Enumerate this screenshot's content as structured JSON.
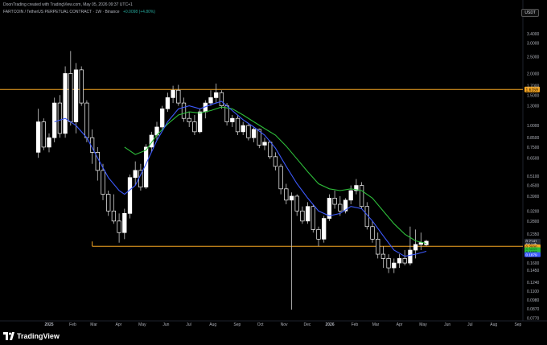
{
  "header": {
    "credit": "DoonTrading created with TradingView.com, May 05, 2026 09:37 UTC+1",
    "symbol_line": "FARTCOIN / TetherUS PERPETUAL CONTRACT · 1W · Binance",
    "change": "+0.0098 (+4.80%)",
    "currency_badge": "USDT"
  },
  "brand": {
    "name": "TradingView"
  },
  "colors": {
    "background": "#000000",
    "candle_up": "#ffffff",
    "candle_down": "#ffffff",
    "ma_fast": "#3d5afe",
    "ma_slow": "#2ebd3a",
    "level_line": "#f5a623",
    "change_text": "#26a69a"
  },
  "chart_data": {
    "type": "candlestick",
    "y_scale": "log",
    "ylim": [
      0.074,
      4.3
    ],
    "y_ticks": [
      "3.4000",
      "3.0000",
      "2.5000",
      "2.0000",
      "1.7000",
      "1.5000",
      "1.3000",
      "1.0000",
      "0.8500",
      "0.7500",
      "0.6500",
      "0.5100",
      "0.4500",
      "0.3900",
      "0.3200",
      "0.2800",
      "0.2350",
      "0.1900",
      "0.1600",
      "0.1450",
      "0.1240",
      "0.1100",
      "0.0980",
      "0.0870",
      "0.0770"
    ],
    "y_tick_values": [
      3.4,
      3.0,
      2.5,
      2.0,
      1.7,
      1.5,
      1.3,
      1.0,
      0.85,
      0.75,
      0.65,
      0.51,
      0.45,
      0.39,
      0.32,
      0.28,
      0.235,
      0.19,
      0.16,
      0.145,
      0.124,
      0.11,
      0.098,
      0.087,
      0.077
    ],
    "x_labels": [
      "2025",
      "Feb",
      "Mar",
      "Apr",
      "May",
      "Jun",
      "Jul",
      "Aug",
      "Sep",
      "Oct",
      "Nov",
      "Dec",
      "2026",
      "Feb",
      "Mar",
      "Apr",
      "May",
      "Jun",
      "Jul",
      "Aug",
      "Sep"
    ],
    "x_label_weeks": [
      0,
      4.4,
      8.3,
      12.9,
      17.3,
      21.7,
      25.9,
      30.4,
      34.9,
      39.2,
      43.6,
      47.9,
      52.1,
      56.7,
      60.6,
      65.0,
      69.4,
      73.9,
      78.1,
      82.5,
      87.0
    ],
    "candles": [
      {
        "w": -2,
        "o": 0.7,
        "h": 1.25,
        "l": 0.65,
        "c": 1.05
      },
      {
        "w": -1,
        "o": 1.05,
        "h": 1.1,
        "l": 0.72,
        "c": 0.75
      },
      {
        "w": 0,
        "o": 0.75,
        "h": 0.9,
        "l": 0.7,
        "c": 0.85
      },
      {
        "w": 1,
        "o": 0.85,
        "h": 1.45,
        "l": 0.8,
        "c": 1.35
      },
      {
        "w": 2,
        "o": 1.35,
        "h": 1.5,
        "l": 0.85,
        "c": 0.9
      },
      {
        "w": 3,
        "o": 0.9,
        "h": 2.2,
        "l": 0.85,
        "c": 2.0
      },
      {
        "w": 4,
        "o": 2.0,
        "h": 2.7,
        "l": 1.0,
        "c": 1.05
      },
      {
        "w": 5,
        "o": 1.05,
        "h": 2.3,
        "l": 0.9,
        "c": 2.1
      },
      {
        "w": 6,
        "o": 2.1,
        "h": 2.2,
        "l": 1.3,
        "c": 1.35
      },
      {
        "w": 7,
        "o": 1.35,
        "h": 1.4,
        "l": 0.8,
        "c": 0.85
      },
      {
        "w": 8,
        "o": 0.85,
        "h": 0.95,
        "l": 0.6,
        "c": 0.7
      },
      {
        "w": 9,
        "o": 0.7,
        "h": 0.75,
        "l": 0.48,
        "c": 0.55
      },
      {
        "w": 10,
        "o": 0.55,
        "h": 0.6,
        "l": 0.37,
        "c": 0.4
      },
      {
        "w": 11,
        "o": 0.4,
        "h": 0.42,
        "l": 0.3,
        "c": 0.32
      },
      {
        "w": 12,
        "o": 0.32,
        "h": 0.4,
        "l": 0.27,
        "c": 0.28
      },
      {
        "w": 13,
        "o": 0.28,
        "h": 0.31,
        "l": 0.21,
        "c": 0.24
      },
      {
        "w": 14,
        "o": 0.24,
        "h": 0.33,
        "l": 0.22,
        "c": 0.31
      },
      {
        "w": 15,
        "o": 0.31,
        "h": 0.52,
        "l": 0.29,
        "c": 0.5
      },
      {
        "w": 16,
        "o": 0.5,
        "h": 0.62,
        "l": 0.45,
        "c": 0.55
      },
      {
        "w": 17,
        "o": 0.55,
        "h": 0.6,
        "l": 0.42,
        "c": 0.44
      },
      {
        "w": 18,
        "o": 0.44,
        "h": 0.78,
        "l": 0.43,
        "c": 0.75
      },
      {
        "w": 19,
        "o": 0.75,
        "h": 0.92,
        "l": 0.7,
        "c": 0.88
      },
      {
        "w": 20,
        "o": 0.88,
        "h": 1.05,
        "l": 0.82,
        "c": 0.98
      },
      {
        "w": 21,
        "o": 0.98,
        "h": 1.3,
        "l": 0.95,
        "c": 1.25
      },
      {
        "w": 22,
        "o": 1.25,
        "h": 1.55,
        "l": 1.2,
        "c": 1.45
      },
      {
        "w": 23,
        "o": 1.45,
        "h": 1.7,
        "l": 1.35,
        "c": 1.6
      },
      {
        "w": 24,
        "o": 1.6,
        "h": 1.72,
        "l": 1.3,
        "c": 1.35
      },
      {
        "w": 25,
        "o": 1.35,
        "h": 1.45,
        "l": 1.05,
        "c": 1.1
      },
      {
        "w": 26,
        "o": 1.1,
        "h": 1.2,
        "l": 0.98,
        "c": 1.05
      },
      {
        "w": 27,
        "o": 1.05,
        "h": 1.15,
        "l": 0.88,
        "c": 0.92
      },
      {
        "w": 28,
        "o": 0.92,
        "h": 1.25,
        "l": 0.9,
        "c": 1.2
      },
      {
        "w": 29,
        "o": 1.2,
        "h": 1.4,
        "l": 1.1,
        "c": 1.35
      },
      {
        "w": 30,
        "o": 1.35,
        "h": 1.6,
        "l": 1.3,
        "c": 1.45
      },
      {
        "w": 31,
        "o": 1.45,
        "h": 1.75,
        "l": 1.35,
        "c": 1.55
      },
      {
        "w": 32,
        "o": 1.55,
        "h": 1.6,
        "l": 1.25,
        "c": 1.3
      },
      {
        "w": 33,
        "o": 1.3,
        "h": 1.35,
        "l": 1.0,
        "c": 1.05
      },
      {
        "w": 34,
        "o": 1.05,
        "h": 1.15,
        "l": 0.98,
        "c": 1.1
      },
      {
        "w": 35,
        "o": 1.1,
        "h": 1.15,
        "l": 0.88,
        "c": 0.92
      },
      {
        "w": 36,
        "o": 0.92,
        "h": 1.05,
        "l": 0.88,
        "c": 1.0
      },
      {
        "w": 37,
        "o": 1.0,
        "h": 1.02,
        "l": 0.82,
        "c": 0.85
      },
      {
        "w": 38,
        "o": 0.85,
        "h": 0.98,
        "l": 0.8,
        "c": 0.95
      },
      {
        "w": 39,
        "o": 0.95,
        "h": 0.96,
        "l": 0.74,
        "c": 0.77
      },
      {
        "w": 40,
        "o": 0.77,
        "h": 0.85,
        "l": 0.72,
        "c": 0.8
      },
      {
        "w": 41,
        "o": 0.8,
        "h": 0.82,
        "l": 0.64,
        "c": 0.66
      },
      {
        "w": 42,
        "o": 0.66,
        "h": 0.7,
        "l": 0.55,
        "c": 0.58
      },
      {
        "w": 43,
        "o": 0.58,
        "h": 0.6,
        "l": 0.4,
        "c": 0.43
      },
      {
        "w": 44,
        "o": 0.43,
        "h": 0.46,
        "l": 0.35,
        "c": 0.37
      },
      {
        "w": 45,
        "o": 0.37,
        "h": 0.41,
        "l": 0.086,
        "c": 0.39
      },
      {
        "w": 46,
        "o": 0.39,
        "h": 0.4,
        "l": 0.3,
        "c": 0.32
      },
      {
        "w": 47,
        "o": 0.32,
        "h": 0.34,
        "l": 0.27,
        "c": 0.28
      },
      {
        "w": 48,
        "o": 0.28,
        "h": 0.36,
        "l": 0.27,
        "c": 0.34
      },
      {
        "w": 49,
        "o": 0.34,
        "h": 0.35,
        "l": 0.24,
        "c": 0.25
      },
      {
        "w": 50,
        "o": 0.25,
        "h": 0.26,
        "l": 0.2,
        "c": 0.22
      },
      {
        "w": 51,
        "o": 0.22,
        "h": 0.3,
        "l": 0.21,
        "c": 0.29
      },
      {
        "w": 52,
        "o": 0.29,
        "h": 0.4,
        "l": 0.28,
        "c": 0.38
      },
      {
        "w": 53,
        "o": 0.38,
        "h": 0.42,
        "l": 0.33,
        "c": 0.35
      },
      {
        "w": 54,
        "o": 0.35,
        "h": 0.39,
        "l": 0.3,
        "c": 0.32
      },
      {
        "w": 55,
        "o": 0.32,
        "h": 0.38,
        "l": 0.31,
        "c": 0.37
      },
      {
        "w": 56,
        "o": 0.37,
        "h": 0.45,
        "l": 0.35,
        "c": 0.42
      },
      {
        "w": 57,
        "o": 0.42,
        "h": 0.49,
        "l": 0.4,
        "c": 0.45
      },
      {
        "w": 58,
        "o": 0.45,
        "h": 0.47,
        "l": 0.33,
        "c": 0.34
      },
      {
        "w": 59,
        "o": 0.34,
        "h": 0.36,
        "l": 0.25,
        "c": 0.26
      },
      {
        "w": 60,
        "o": 0.26,
        "h": 0.28,
        "l": 0.21,
        "c": 0.22
      },
      {
        "w": 61,
        "o": 0.22,
        "h": 0.24,
        "l": 0.17,
        "c": 0.18
      },
      {
        "w": 62,
        "o": 0.18,
        "h": 0.2,
        "l": 0.15,
        "c": 0.17
      },
      {
        "w": 63,
        "o": 0.17,
        "h": 0.18,
        "l": 0.14,
        "c": 0.15
      },
      {
        "w": 64,
        "o": 0.15,
        "h": 0.17,
        "l": 0.14,
        "c": 0.16
      },
      {
        "w": 65,
        "o": 0.16,
        "h": 0.18,
        "l": 0.15,
        "c": 0.17
      },
      {
        "w": 66,
        "o": 0.17,
        "h": 0.19,
        "l": 0.155,
        "c": 0.16
      },
      {
        "w": 67,
        "o": 0.16,
        "h": 0.26,
        "l": 0.155,
        "c": 0.19
      },
      {
        "w": 68,
        "o": 0.19,
        "h": 0.25,
        "l": 0.17,
        "c": 0.205
      },
      {
        "w": 69,
        "o": 0.205,
        "h": 0.24,
        "l": 0.19,
        "c": 0.21
      },
      {
        "w": 70,
        "o": 0.204,
        "h": 0.218,
        "l": 0.2,
        "c": 0.214
      }
    ],
    "ma_fast_values": [
      {
        "w": 1,
        "v": 1.05
      },
      {
        "w": 3,
        "v": 1.1
      },
      {
        "w": 5,
        "v": 1.0
      },
      {
        "w": 7,
        "v": 0.85
      },
      {
        "w": 9,
        "v": 0.65
      },
      {
        "w": 11,
        "v": 0.5
      },
      {
        "w": 13,
        "v": 0.42
      },
      {
        "w": 14,
        "v": 0.4
      },
      {
        "w": 16,
        "v": 0.45
      },
      {
        "w": 18,
        "v": 0.6
      },
      {
        "w": 20,
        "v": 0.82
      },
      {
        "w": 22,
        "v": 1.05
      },
      {
        "w": 24,
        "v": 1.25
      },
      {
        "w": 26,
        "v": 1.3
      },
      {
        "w": 28,
        "v": 1.25
      },
      {
        "w": 30,
        "v": 1.32
      },
      {
        "w": 32,
        "v": 1.38
      },
      {
        "w": 34,
        "v": 1.22
      },
      {
        "w": 36,
        "v": 1.08
      },
      {
        "w": 38,
        "v": 0.98
      },
      {
        "w": 40,
        "v": 0.88
      },
      {
        "w": 42,
        "v": 0.74
      },
      {
        "w": 44,
        "v": 0.58
      },
      {
        "w": 46,
        "v": 0.46
      },
      {
        "w": 48,
        "v": 0.38
      },
      {
        "w": 50,
        "v": 0.32
      },
      {
        "w": 52,
        "v": 0.3
      },
      {
        "w": 54,
        "v": 0.31
      },
      {
        "w": 56,
        "v": 0.34
      },
      {
        "w": 58,
        "v": 0.33
      },
      {
        "w": 60,
        "v": 0.28
      },
      {
        "w": 62,
        "v": 0.23
      },
      {
        "w": 64,
        "v": 0.19
      },
      {
        "w": 66,
        "v": 0.175
      },
      {
        "w": 68,
        "v": 0.18
      },
      {
        "w": 70,
        "v": 0.187
      }
    ],
    "ma_slow_values": [
      {
        "w": 14,
        "v": 0.75
      },
      {
        "w": 16,
        "v": 0.68
      },
      {
        "w": 18,
        "v": 0.72
      },
      {
        "w": 20,
        "v": 0.88
      },
      {
        "w": 22,
        "v": 1.02
      },
      {
        "w": 24,
        "v": 1.15
      },
      {
        "w": 26,
        "v": 1.2
      },
      {
        "w": 28,
        "v": 1.18
      },
      {
        "w": 30,
        "v": 1.22
      },
      {
        "w": 32,
        "v": 1.28
      },
      {
        "w": 34,
        "v": 1.25
      },
      {
        "w": 36,
        "v": 1.15
      },
      {
        "w": 38,
        "v": 1.05
      },
      {
        "w": 40,
        "v": 0.96
      },
      {
        "w": 42,
        "v": 0.88
      },
      {
        "w": 44,
        "v": 0.76
      },
      {
        "w": 46,
        "v": 0.64
      },
      {
        "w": 48,
        "v": 0.54
      },
      {
        "w": 50,
        "v": 0.46
      },
      {
        "w": 52,
        "v": 0.43
      },
      {
        "w": 54,
        "v": 0.42
      },
      {
        "w": 56,
        "v": 0.43
      },
      {
        "w": 58,
        "v": 0.42
      },
      {
        "w": 60,
        "v": 0.38
      },
      {
        "w": 62,
        "v": 0.32
      },
      {
        "w": 64,
        "v": 0.27
      },
      {
        "w": 66,
        "v": 0.235
      },
      {
        "w": 68,
        "v": 0.215
      },
      {
        "w": 70,
        "v": 0.208
      }
    ],
    "level_lines": [
      {
        "value": 1.6159,
        "label": "1.6159",
        "from_week": -2
      },
      {
        "value": 0.2,
        "label": "",
        "from_week": 8
      }
    ],
    "price_labels": [
      {
        "value": 0.2141,
        "label": "0.2141",
        "color": "#2a2e39",
        "text_color": "#ffffff"
      },
      {
        "value": 0.205,
        "label": "6d 14h",
        "color": "#2a2e39",
        "text_color": "#ffffff"
      },
      {
        "value": 0.1985,
        "label": "0.2000",
        "color": "#f5a623",
        "text_color": "#000000"
      },
      {
        "value": 0.191,
        "label": "0.2083",
        "color": "#2ebd3a",
        "text_color": "#000000"
      },
      {
        "value": 0.185,
        "label": "0.1957",
        "color": "#2ebd3a",
        "text_color": "#000000"
      },
      {
        "value": 0.179,
        "label": "0.1879",
        "color": "#3d5afe",
        "text_color": "#ffffff"
      }
    ]
  }
}
